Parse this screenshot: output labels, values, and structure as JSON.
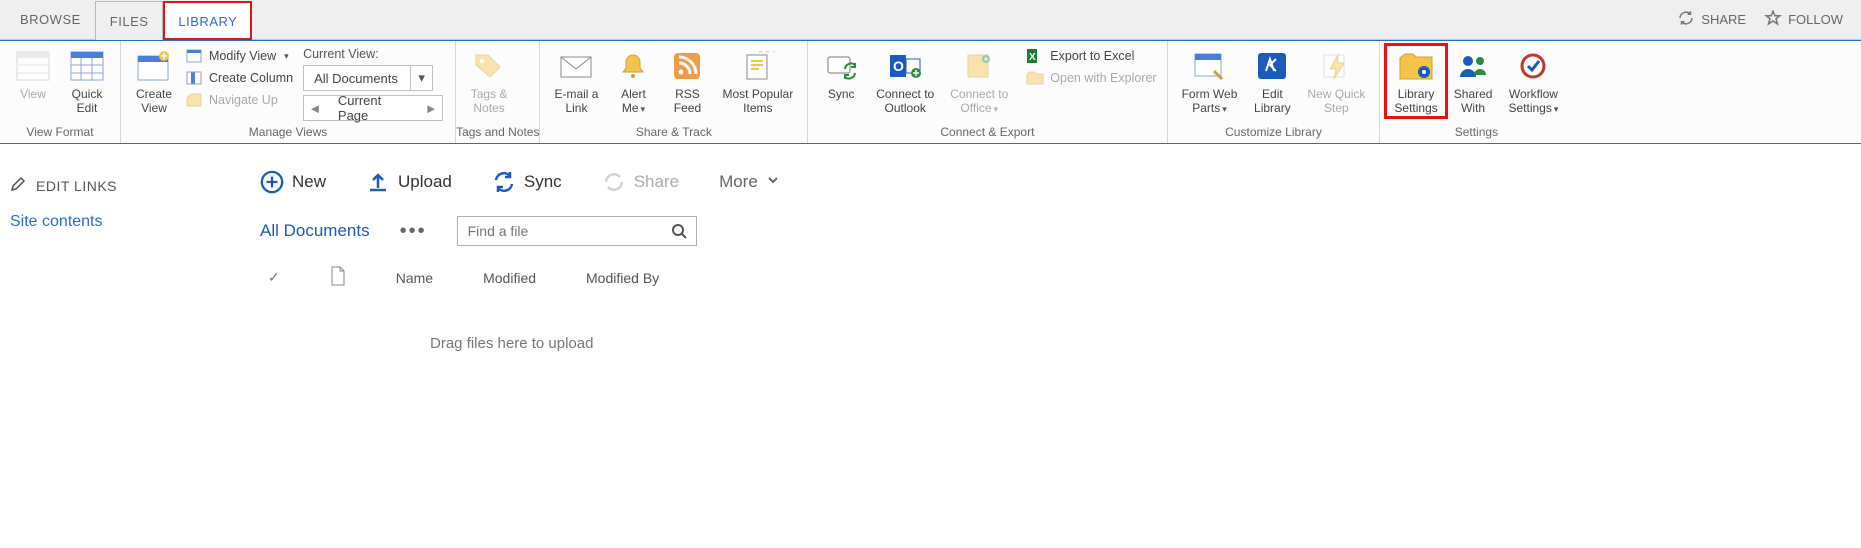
{
  "tabs": {
    "browse": "BROWSE",
    "files": "FILES",
    "library": "LIBRARY"
  },
  "pageActions": {
    "share": "SHARE",
    "follow": "FOLLOW"
  },
  "ribbon": {
    "viewFormat": {
      "label": "View Format",
      "view": "View",
      "quickEdit": "Quick\nEdit"
    },
    "manageViews": {
      "label": "Manage Views",
      "createView": "Create\nView",
      "modifyView": "Modify View",
      "createColumn": "Create Column",
      "navigateUp": "Navigate Up",
      "currentViewLabel": "Current View:",
      "currentView": "All Documents",
      "currentPage": "Current Page"
    },
    "tagsNotes": {
      "label": "Tags and Notes",
      "tagsNotes": "Tags &\nNotes"
    },
    "shareTrack": {
      "label": "Share & Track",
      "emailLink": "E-mail a\nLink",
      "alertMe": "Alert\nMe",
      "rssFeed": "RSS\nFeed",
      "mostPopular": "Most Popular\nItems"
    },
    "connectExport": {
      "label": "Connect & Export",
      "sync": "Sync",
      "connectOutlook": "Connect to\nOutlook",
      "connectOffice": "Connect to\nOffice",
      "exportExcel": "Export to Excel",
      "openExplorer": "Open with Explorer"
    },
    "customize": {
      "label": "Customize Library",
      "formWebParts": "Form Web\nParts",
      "editLibrary": "Edit\nLibrary",
      "newQuickStep": "New Quick\nStep"
    },
    "settings": {
      "label": "Settings",
      "librarySettings": "Library\nSettings",
      "sharedWith": "Shared\nWith",
      "workflowSettings": "Workflow\nSettings"
    }
  },
  "leftnav": {
    "editLinks": "EDIT LINKS",
    "siteContents": "Site contents"
  },
  "actionBar": {
    "new": "New",
    "upload": "Upload",
    "sync": "Sync",
    "share": "Share",
    "more": "More"
  },
  "viewBar": {
    "viewName": "All Documents",
    "searchPlaceholder": "Find a file"
  },
  "columns": {
    "name": "Name",
    "modified": "Modified",
    "modifiedBy": "Modified By"
  },
  "dragText": "Drag files here to upload"
}
